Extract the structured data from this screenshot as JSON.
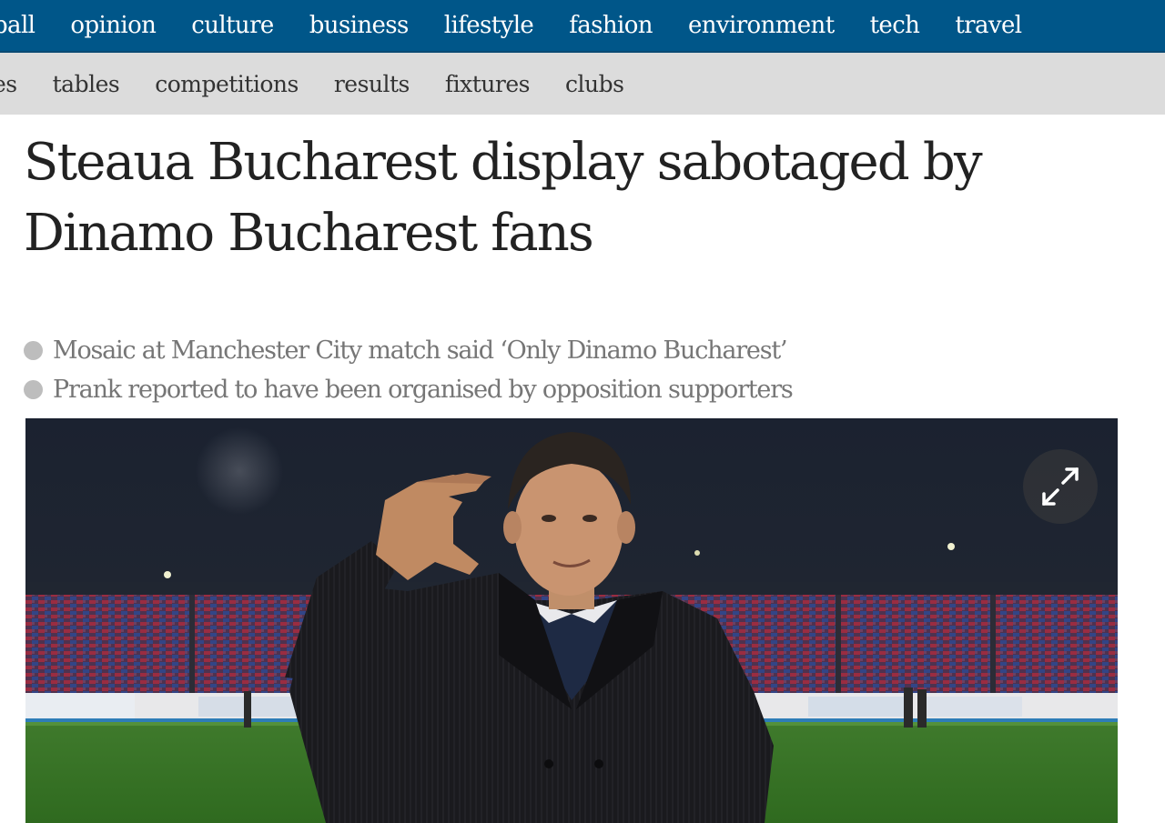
{
  "nav_primary": {
    "items": [
      "ball",
      "opinion",
      "culture",
      "business",
      "lifestyle",
      "fashion",
      "environment",
      "tech",
      "travel"
    ]
  },
  "nav_secondary": {
    "items": [
      "es",
      "tables",
      "competitions",
      "results",
      "fixtures",
      "clubs"
    ]
  },
  "article": {
    "headline_line1": "Steaua Bucharest display sabotaged by",
    "headline_line2": "Dinamo Bucharest fans",
    "standfirst": [
      "Mosaic at Manchester City match said ‘Only Dinamo Bucharest’",
      "Prank reported to have been organised by opposition supporters"
    ]
  },
  "hero_image": {
    "expand_icon": "expand-icon"
  },
  "colors": {
    "nav_primary_bg": "#005689",
    "nav_secondary_bg": "#dcdcdc",
    "headline_text": "#222222",
    "standfirst_text": "#767676",
    "bullet": "#bdbdbd"
  }
}
